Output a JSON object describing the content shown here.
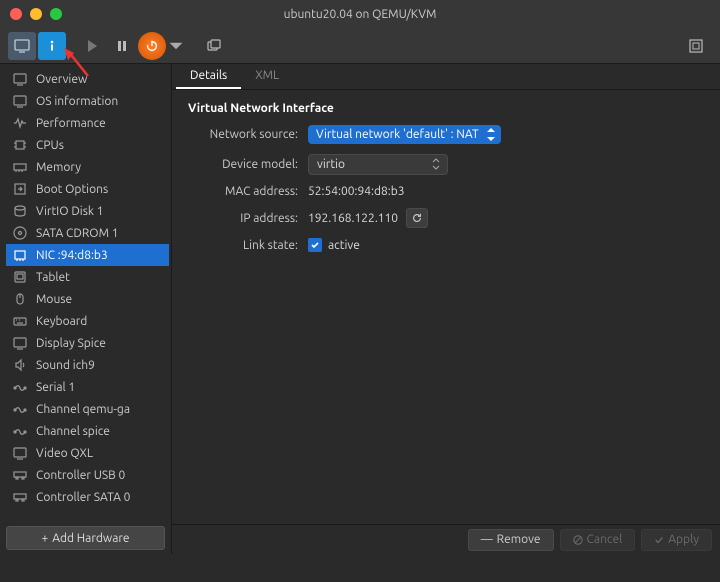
{
  "window": {
    "title": "ubuntu20.04 on QEMU/KVM"
  },
  "traffic": {
    "close": "#ff5f57",
    "min": "#febc2e",
    "max": "#28c840"
  },
  "sidebar": {
    "items": [
      {
        "label": "Overview",
        "icon": "monitor"
      },
      {
        "label": "OS information",
        "icon": "monitor"
      },
      {
        "label": "Performance",
        "icon": "pulse"
      },
      {
        "label": "CPUs",
        "icon": "chip"
      },
      {
        "label": "Memory",
        "icon": "ram"
      },
      {
        "label": "Boot Options",
        "icon": "arrow-box"
      },
      {
        "label": "VirtIO Disk 1",
        "icon": "disk"
      },
      {
        "label": "SATA CDROM 1",
        "icon": "cd"
      },
      {
        "label": "NIC :94:d8:b3",
        "icon": "nic",
        "selected": true
      },
      {
        "label": "Tablet",
        "icon": "tablet"
      },
      {
        "label": "Mouse",
        "icon": "mouse"
      },
      {
        "label": "Keyboard",
        "icon": "keyboard"
      },
      {
        "label": "Display Spice",
        "icon": "monitor"
      },
      {
        "label": "Sound ich9",
        "icon": "speaker"
      },
      {
        "label": "Serial 1",
        "icon": "port"
      },
      {
        "label": "Channel qemu-ga",
        "icon": "port"
      },
      {
        "label": "Channel spice",
        "icon": "port"
      },
      {
        "label": "Video QXL",
        "icon": "monitor"
      },
      {
        "label": "Controller USB 0",
        "icon": "controller"
      },
      {
        "label": "Controller SATA 0",
        "icon": "controller"
      }
    ],
    "add_hw": "Add Hardware"
  },
  "tabs": {
    "details": "Details",
    "xml": "XML"
  },
  "panel": {
    "title": "Virtual Network Interface",
    "labels": {
      "network_source": "Network source:",
      "device_model": "Device model:",
      "mac": "MAC address:",
      "ip": "IP address:",
      "link": "Link state:"
    },
    "values": {
      "network_source": "Virtual network 'default' : NAT",
      "device_model": "virtio",
      "mac": "52:54:00:94:d8:b3",
      "ip": "192.168.122.110",
      "link_active": "active"
    }
  },
  "footer": {
    "remove": "Remove",
    "cancel": "Cancel",
    "apply": "Apply"
  }
}
